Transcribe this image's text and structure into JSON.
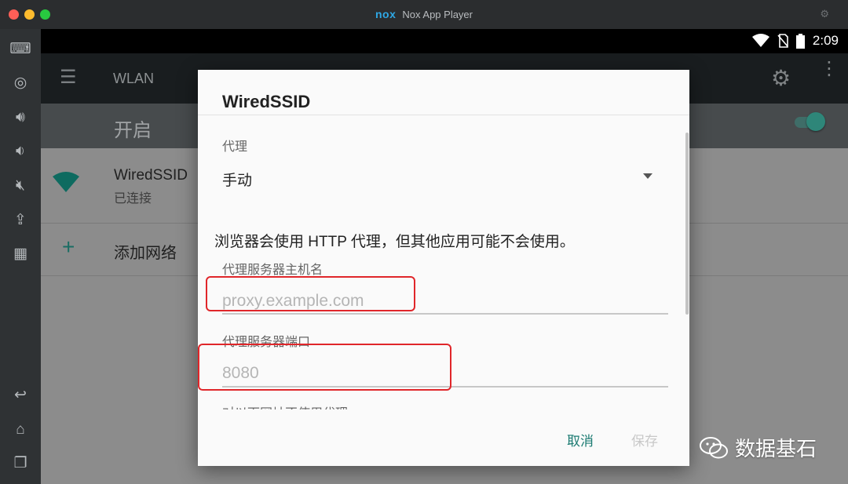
{
  "window": {
    "title": "Nox App Player",
    "logo_text": "nox"
  },
  "status_bar": {
    "time": "2:09"
  },
  "app_bar": {
    "title": "WLAN"
  },
  "wlan_switch": {
    "label": "开启"
  },
  "network": {
    "ssid": "WiredSSID",
    "status": "已连接"
  },
  "add_network": {
    "label": "添加网络"
  },
  "dialog": {
    "title": "WiredSSID",
    "proxy_label": "代理",
    "proxy_value": "手动",
    "warning": "浏览器会使用 HTTP 代理，但其他应用可能不会使用。",
    "host_label": "代理服务器主机名",
    "host_placeholder": "proxy.example.com",
    "port_label": "代理服务器端口",
    "port_placeholder": "8080",
    "bypass_label_partial": "对以下网址不使用代理",
    "cancel": "取消",
    "save": "保存"
  },
  "watermark": {
    "text": "数据基石"
  },
  "colors": {
    "accent": "#1a7a71",
    "highlight": "#e0262a",
    "nox_blue": "#2ea8e6"
  }
}
